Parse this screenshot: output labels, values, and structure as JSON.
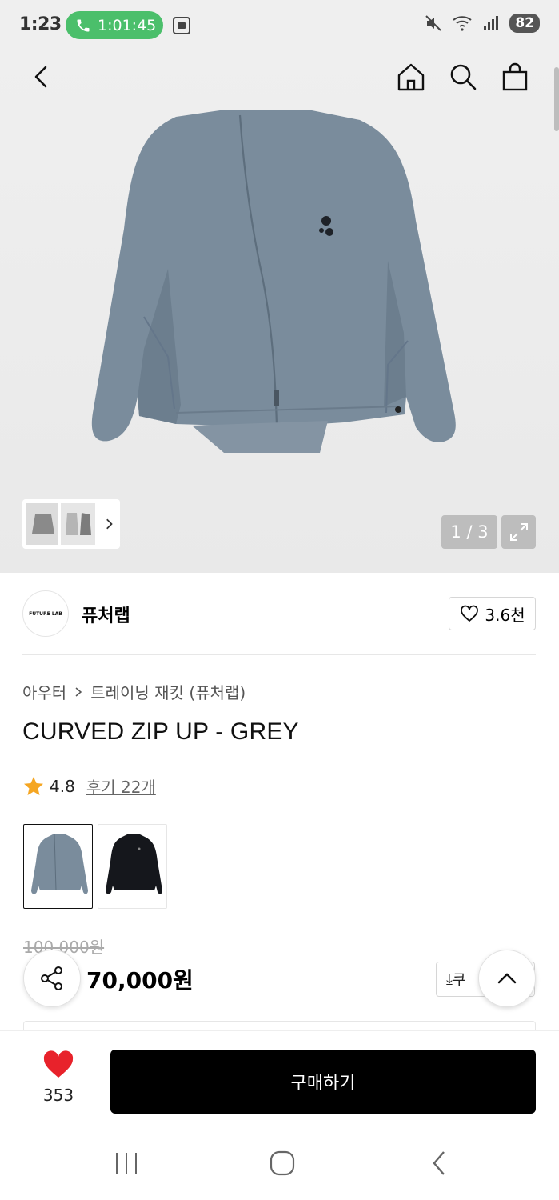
{
  "status_bar": {
    "time": "1:23",
    "call_timer": "1:01:45",
    "battery": "82"
  },
  "nav": {
    "back_icon": "chevron-left-icon",
    "home_icon": "home-icon",
    "search_icon": "search-icon",
    "cart_icon": "shopping-bag-icon"
  },
  "gallery": {
    "counter": "1 / 3",
    "colors": {
      "jacket": "#7a8c9c",
      "jacket_shade": "#6c7e8e",
      "background": "#ececec"
    }
  },
  "brand": {
    "logo_text": "FUTURE LAB",
    "name": "퓨처랩",
    "like_count": "3.6천"
  },
  "product": {
    "breadcrumb": [
      "아우터",
      "트레이닝 재킷 (퓨처랩)"
    ],
    "title": "CURVED ZIP UP - GREY",
    "rating": "4.8",
    "reviews_label": "후기 22개",
    "options": [
      {
        "name": "grey",
        "color": "#7a8c9c",
        "selected": true
      },
      {
        "name": "black",
        "color": "#15171c",
        "selected": false
      }
    ],
    "original_price": "100,000원",
    "price": "70,000원",
    "coupon_label": "쿠"
  },
  "purchase_bar": {
    "wish_count": "353",
    "buy_label": "구매하기",
    "heart_color": "#e8222b"
  }
}
